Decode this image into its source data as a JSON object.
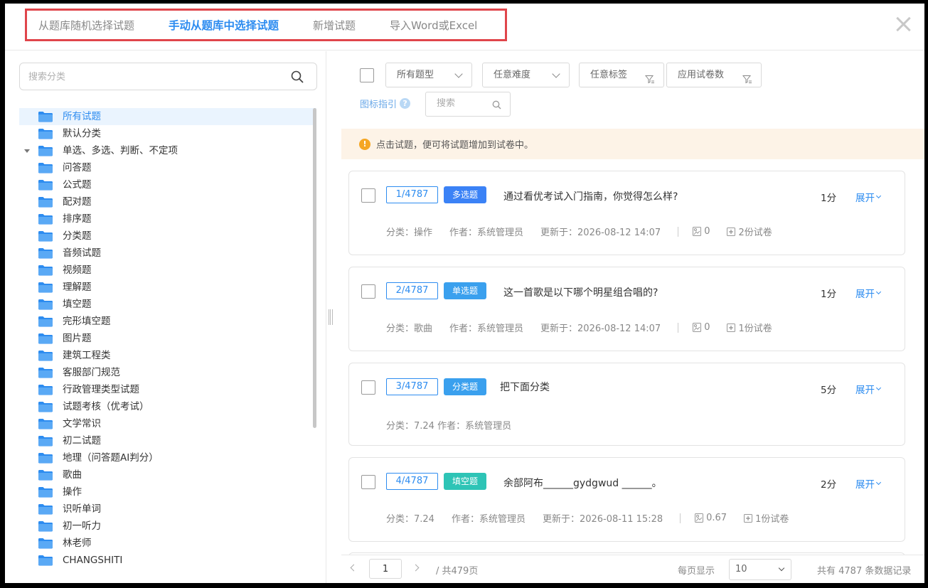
{
  "header": {
    "tabs": [
      {
        "label": "从题库随机选择试题",
        "active": false
      },
      {
        "label": "手动从题库中选择试题",
        "active": true
      },
      {
        "label": "新增试题",
        "active": false
      },
      {
        "label": "导入Word或Excel",
        "active": false
      }
    ]
  },
  "sidebar": {
    "search_placeholder": "搜索分类",
    "categories": [
      "所有试题",
      "默认分类",
      "单选、多选、判断、不定项",
      "问答题",
      "公式题",
      "配对题",
      "排序题",
      "分类题",
      "音频试题",
      "视频题",
      "理解题",
      "填空题",
      "完形填空题",
      "图片题",
      "建筑工程类",
      "客服部门规范",
      "行政管理类型试题",
      "试题考核（优考试）",
      "文学常识",
      "初二试题",
      "地理（问答题AI判分）",
      "歌曲",
      "操作",
      "识听单词",
      "初一听力",
      "林老师",
      "CHANGSHITI"
    ],
    "active_index": 0,
    "expandable_index": 2
  },
  "filters": {
    "type_select": "所有题型",
    "difficulty_select": "任意难度",
    "tag_filter": "任意标签",
    "paper_filter": "应用试卷数",
    "guide_label": "图标指引",
    "search_placeholder": "搜索"
  },
  "notice": "点击试题，便可将试题增加到试卷中。",
  "questions": [
    {
      "index": "1/4787",
      "type": "多选题",
      "type_color": "#3b82f6",
      "title": "通过看优考试入门指南，你觉得怎么样?",
      "score": "1分",
      "expand": "展开",
      "category": "分类：操作",
      "author": "作者：系统管理员",
      "updated": "更新于：2026-08-12 14:07",
      "rate": "0",
      "papers": "2份试卷"
    },
    {
      "index": "2/4787",
      "type": "单选题",
      "type_color": "#3aa0ee",
      "title": "这一首歌是以下哪个明星组合唱的?",
      "score": "1分",
      "expand": "展开",
      "category": "分类：歌曲",
      "author": "作者：系统管理员",
      "updated": "更新于：2026-08-12 14:07",
      "rate": "0",
      "papers": "1份试卷"
    },
    {
      "index": "3/4787",
      "type": "分类题",
      "type_color": "#3aa0ee",
      "title": "把下面分类",
      "score": "5分",
      "expand": "展开",
      "category_author": "分类：7.24 作者：系统管理员"
    },
    {
      "index": "4/4787",
      "type": "填空题",
      "type_color": "#2ec4b6",
      "title": "余部阿布______gydgwud ______。",
      "score": "2分",
      "expand": "展开",
      "category": "分类：7.24",
      "author": "作者：系统管理员",
      "updated": "更新于：2026-08-11 15:28",
      "rate": "0.67",
      "papers": "1份试卷"
    }
  ],
  "pagination": {
    "current_page": "1",
    "total_pages": "/ 共479页",
    "per_page_label": "每页显示",
    "per_page": "10",
    "records": "共有 4787 条数据记录"
  }
}
